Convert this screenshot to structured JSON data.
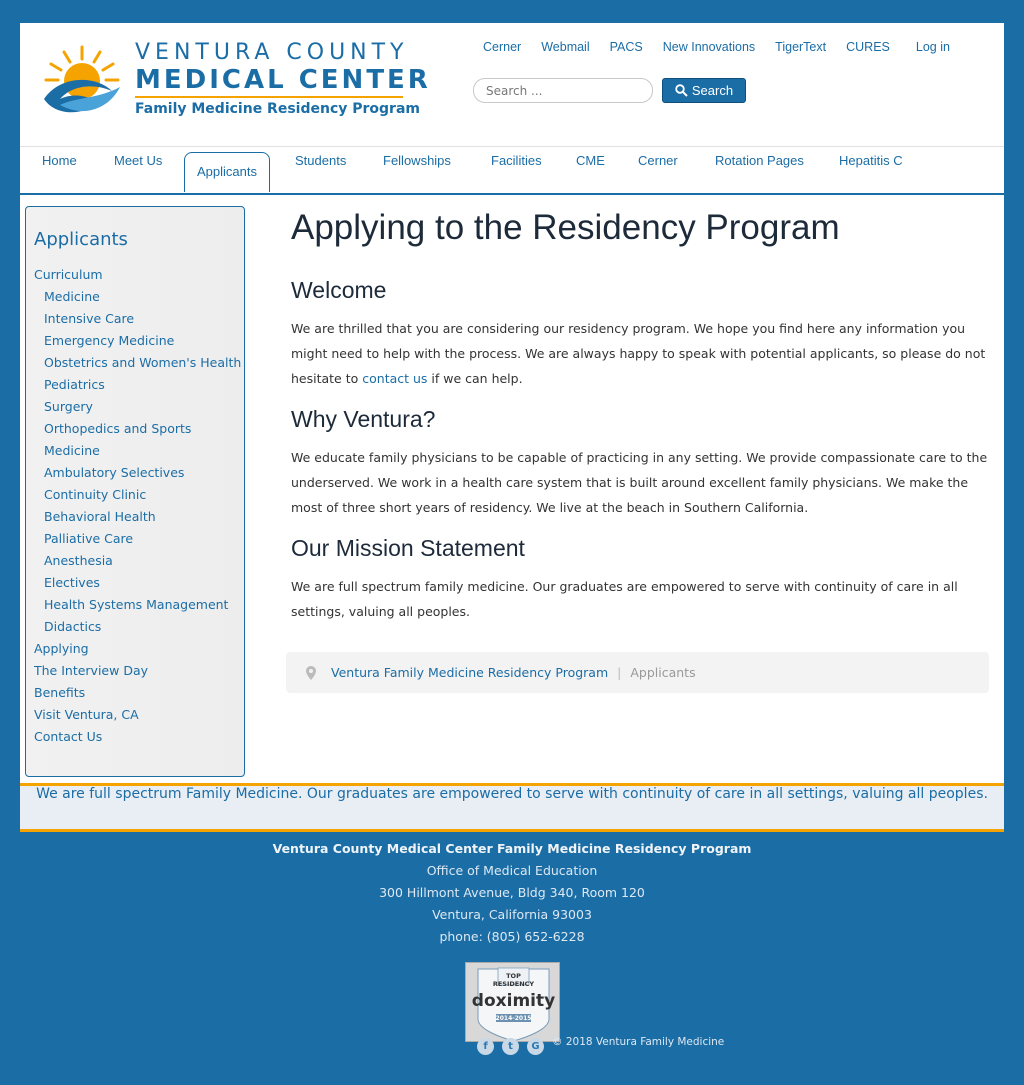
{
  "header": {
    "logo": {
      "line1": "VENTURA COUNTY",
      "line2": "MEDICAL CENTER",
      "line3": "Family Medicine Residency Program"
    },
    "top_links": [
      "Cerner",
      "Webmail",
      "PACS",
      "New Innovations",
      "TigerText",
      "CURES"
    ],
    "login_label": "Log in",
    "search": {
      "placeholder": "Search ...",
      "button_label": "Search"
    }
  },
  "nav": {
    "tabs": [
      "Home",
      "Meet Us",
      "Applicants",
      "Students",
      "Fellowships",
      "Facilities",
      "CME",
      "Cerner",
      "Rotation Pages",
      "Hepatitis C"
    ],
    "active": "Applicants"
  },
  "sidebar": {
    "heading": "Applicants",
    "items": [
      {
        "label": "Curriculum",
        "sub": false
      },
      {
        "label": "Medicine",
        "sub": true
      },
      {
        "label": "Intensive Care",
        "sub": true
      },
      {
        "label": "Emergency Medicine",
        "sub": true
      },
      {
        "label": "Obstetrics and Women's Health",
        "sub": true
      },
      {
        "label": "Pediatrics",
        "sub": true
      },
      {
        "label": "Surgery",
        "sub": true
      },
      {
        "label": "Orthopedics and Sports",
        "sub": true
      },
      {
        "label": "Medicine",
        "sub": true
      },
      {
        "label": "Ambulatory Selectives",
        "sub": true
      },
      {
        "label": "Continuity Clinic",
        "sub": true
      },
      {
        "label": "Behavioral Health",
        "sub": true
      },
      {
        "label": "Palliative Care",
        "sub": true
      },
      {
        "label": "Anesthesia",
        "sub": true
      },
      {
        "label": "Electives",
        "sub": true
      },
      {
        "label": "Health Systems Management",
        "sub": true
      },
      {
        "label": "Didactics",
        "sub": true
      },
      {
        "label": "Applying",
        "sub": false
      },
      {
        "label": "The Interview Day",
        "sub": false
      },
      {
        "label": "Benefits",
        "sub": false
      },
      {
        "label": "Visit Ventura, CA",
        "sub": false
      },
      {
        "label": "Contact Us",
        "sub": false
      }
    ]
  },
  "main": {
    "title": "Applying to the Residency Program",
    "welcome_heading": "Welcome",
    "welcome_text_before": "We are thrilled that you are considering our residency program. We hope you find here any information you might need to help with the process. We are always happy to speak with potential applicants, so please do not hesitate to ",
    "welcome_link": "contact us",
    "welcome_text_after": " if we can help.",
    "why_heading": "Why Ventura?",
    "why_text": "We educate family physicians to be capable of practicing in any setting.  We provide compassionate care to the underserved.  We work in a health care system that is built around excellent family physicians.  We make the most of three short years of residency.  We live at the beach in Southern California.",
    "mission_heading": "Our Mission Statement",
    "mission_text": "We are full spectrum family medicine.  Our graduates are empowered to serve with continuity of care in all settings, valuing all peoples."
  },
  "breadcrumb": {
    "home": "Ventura Family Medicine Residency Program",
    "separator": "|",
    "current": "Applicants"
  },
  "tagline": "We are full spectrum Family Medicine. Our graduates are empowered to serve with continuity of care in all settings, valuing all peoples.",
  "footer": {
    "org": "Ventura County Medical Center Family Medicine Residency Program",
    "office": "Office of Medical Education",
    "address1": "300 Hillmont Avenue, Bldg 340, Room 120",
    "address2": "Ventura, California 93003",
    "phone": "phone: (805) 652-6228",
    "badge": {
      "line1": "TOP",
      "line2": "RESIDENCY",
      "brand": "doximity",
      "years": "2014-2015"
    },
    "social": [
      "f",
      "t",
      "G"
    ],
    "copyright": "© 2018 Ventura Family Medicine"
  },
  "colors": {
    "brand_blue": "#1b6da6",
    "accent_orange": "#f4a300",
    "background": "#1b6da6"
  }
}
